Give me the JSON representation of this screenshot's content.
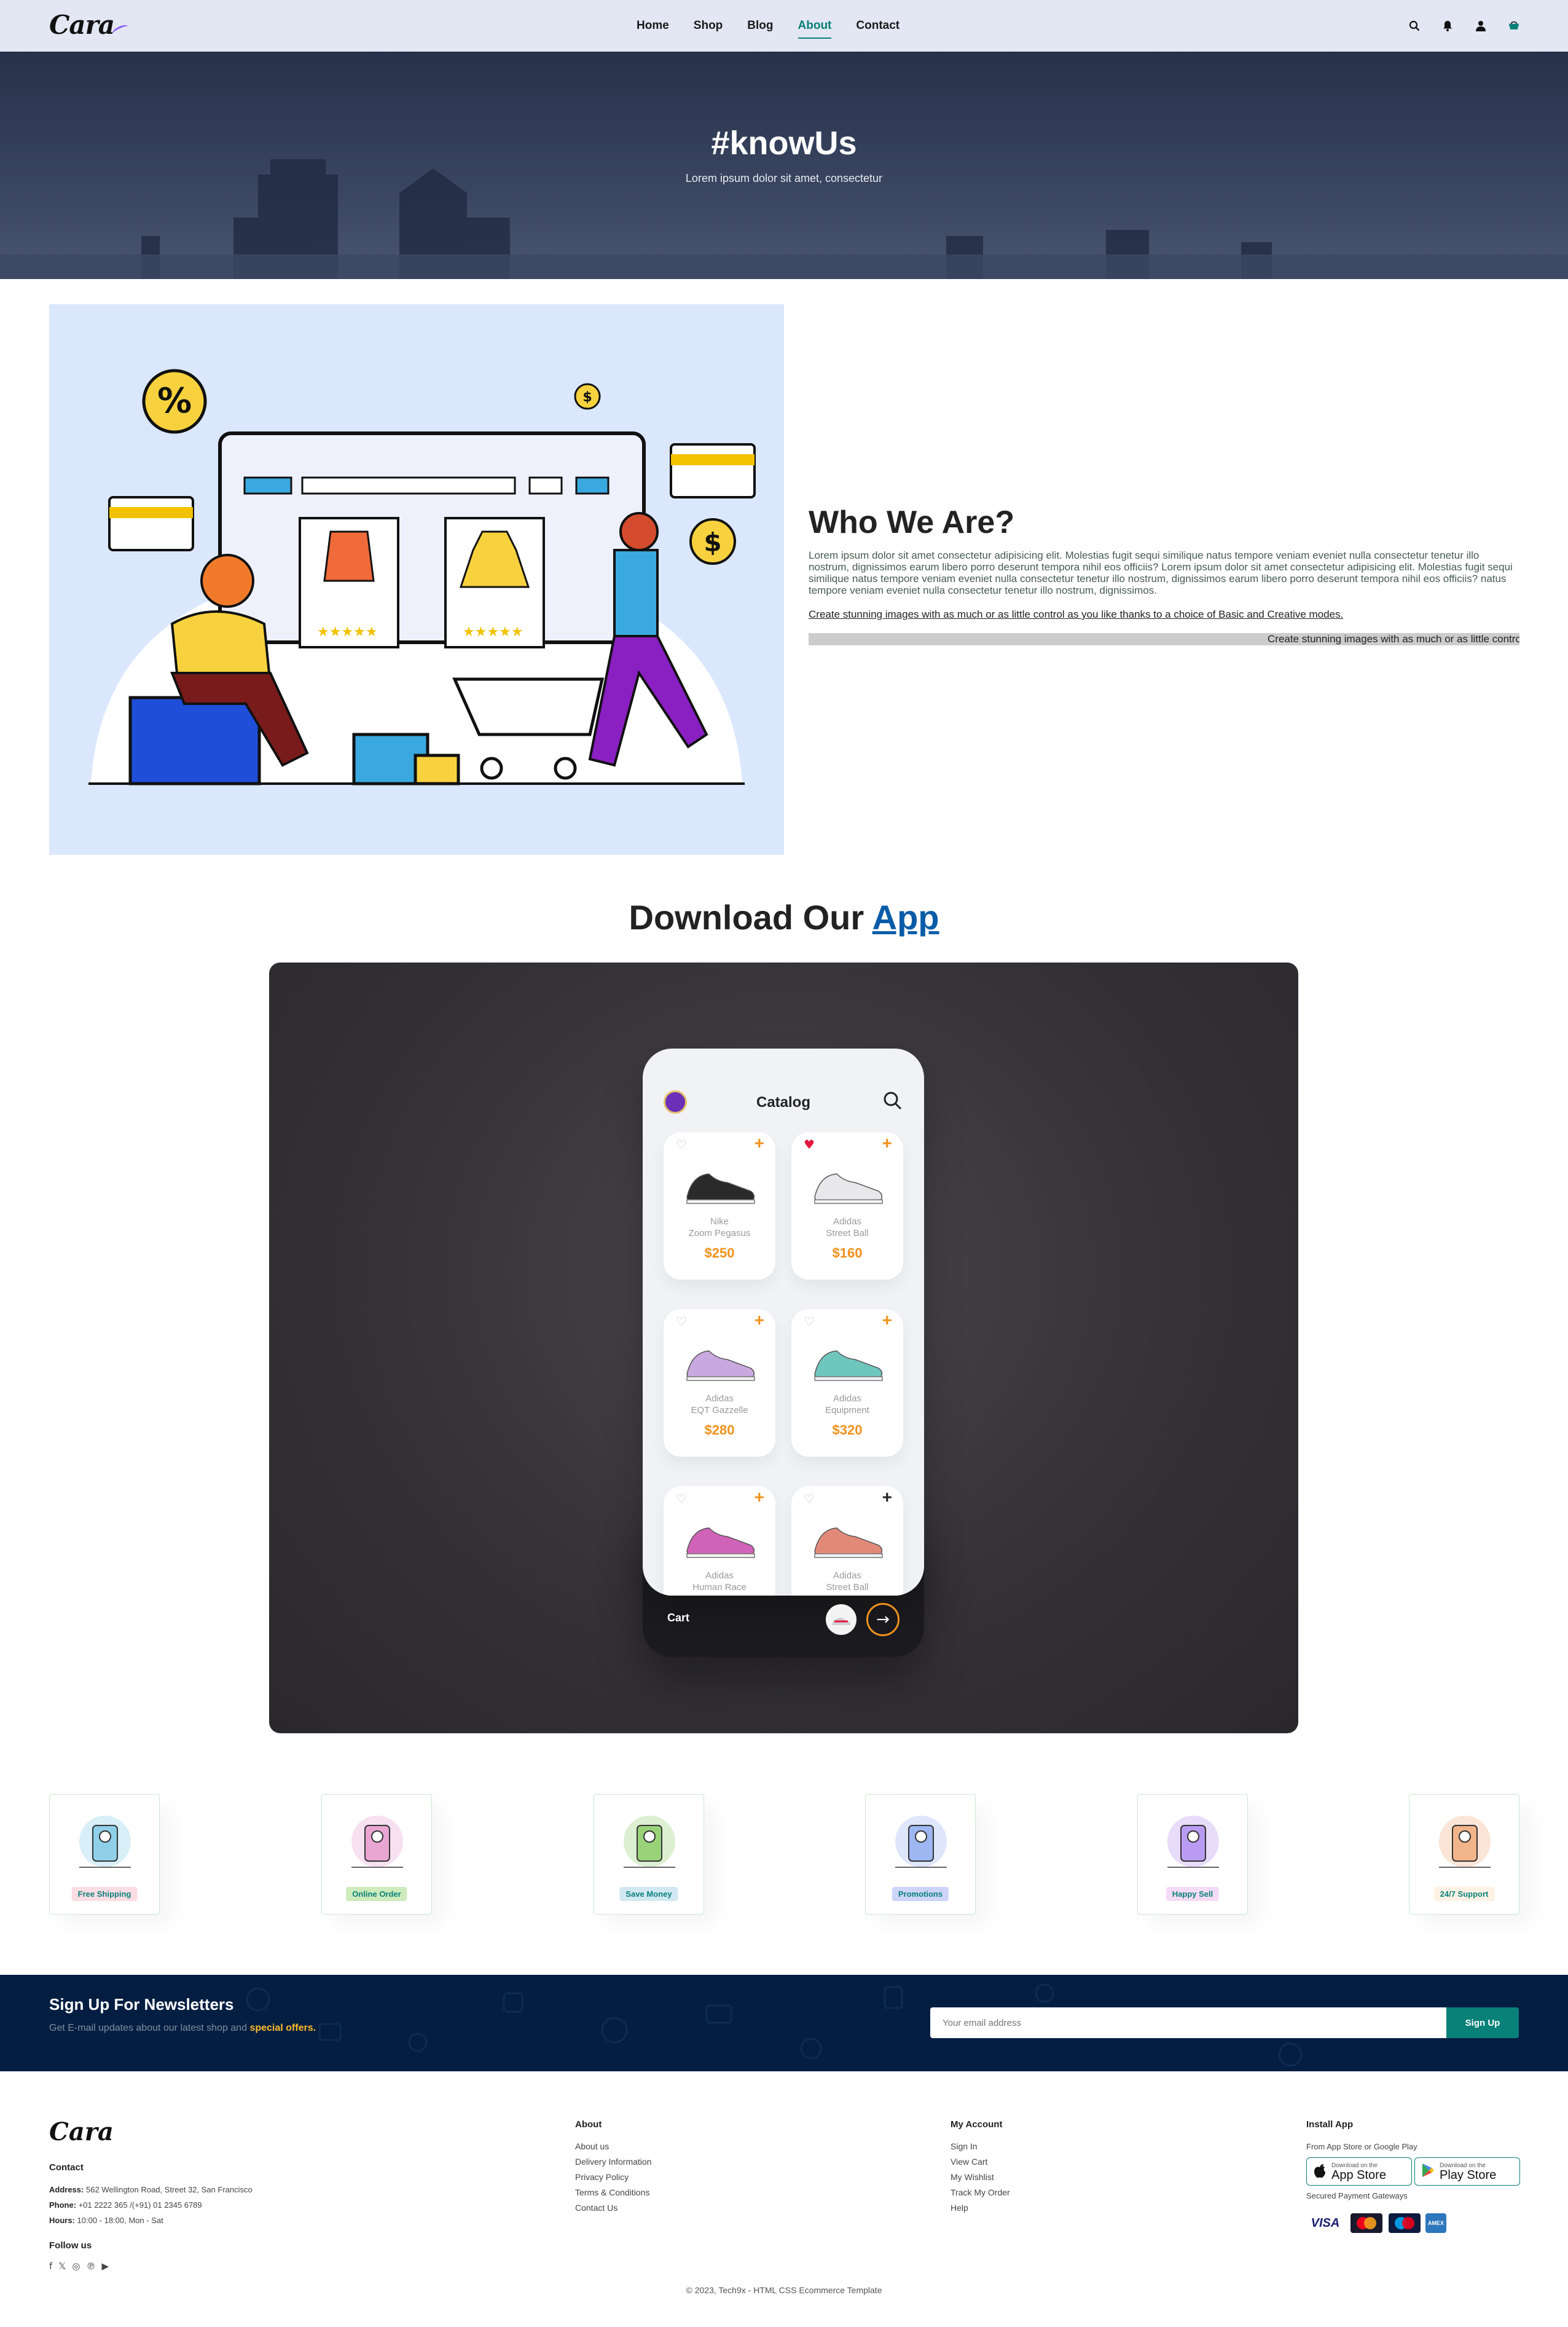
{
  "header": {
    "logo": "Cara",
    "nav": [
      "Home",
      "Shop",
      "Blog",
      "About",
      "Contact"
    ],
    "active_nav": "About",
    "icons": [
      "search-icon",
      "bell-icon",
      "user-icon",
      "cart-icon"
    ]
  },
  "hero": {
    "title": "#knowUs",
    "subtitle": "Lorem ipsum dolor sit amet, consectetur"
  },
  "about": {
    "title": "Who We Are?",
    "lead": "Lorem ipsum dolor sit amet consectetur adipisicing elit. Molestias fugit sequi similique natus tempore veniam eveniet nulla consectetur tenetur illo nostrum, dignissimos earum libero porro deserunt tempora nihil eos officiis? Lorem ipsum dolor sit amet consectetur adipisicing elit. Molestias fugit sequi similique natus tempore veniam eveniet nulla consectetur tenetur illo nostrum, dignissimos earum libero porro deserunt tempora nihil eos officiis? natus tempore veniam eveniet nulla consectetur tenetur illo nostrum, dignissimos.",
    "link_text": "Create stunning images with as much or as little control as you like thanks to a choice of Basic and Creative modes.",
    "marquee": "Create stunning images with as much or as little control as you like thanks to a choice of Basic and Creative modes."
  },
  "app": {
    "title_prefix": "Download Our",
    "title_link": "App",
    "screen_title": "Catalog",
    "cart_label": "Cart",
    "products": [
      {
        "brand": "Nike",
        "model": "Zoom Pegasus",
        "price": "$250",
        "liked": false,
        "plus_color": "orange",
        "shoe_color": "#2a2a2a"
      },
      {
        "brand": "Adidas",
        "model": "Street Ball",
        "price": "$160",
        "liked": true,
        "plus_color": "orange",
        "shoe_color": "#e8e8ea"
      },
      {
        "brand": "Adidas",
        "model": "EQT Gazzelle",
        "price": "$280",
        "liked": false,
        "plus_color": "orange",
        "shoe_color": "#c9a8e0"
      },
      {
        "brand": "Adidas",
        "model": "Equipment",
        "price": "$320",
        "liked": false,
        "plus_color": "orange",
        "shoe_color": "#6fc6bd"
      },
      {
        "brand": "Adidas",
        "model": "Human Race",
        "price": "",
        "liked": false,
        "plus_color": "orange",
        "shoe_color": "#d063b8"
      },
      {
        "brand": "Adidas",
        "model": "Street Ball",
        "price": "",
        "liked": false,
        "plus_color": "dark",
        "shoe_color": "#e28a78"
      }
    ]
  },
  "features": [
    {
      "label": "Free Shipping",
      "bg": "#fddde4"
    },
    {
      "label": "Online Order",
      "bg": "#cdebbc"
    },
    {
      "label": "Save Money",
      "bg": "#d1e8f2"
    },
    {
      "label": "Promotions",
      "bg": "#cdd4f8"
    },
    {
      "label": "Happy Sell",
      "bg": "#f6dbf6"
    },
    {
      "label": "24/7 Support",
      "bg": "#fff2e5"
    }
  ],
  "newsletter": {
    "title": "Sign Up For Newsletters",
    "text": "Get E-mail updates about our latest shop and",
    "highlight": "special offers.",
    "placeholder": "Your email address",
    "button": "Sign Up"
  },
  "footer": {
    "logo": "Cara",
    "contact_title": "Contact",
    "address_label": "Address:",
    "address": "562 Wellington Road, Street 32, San Francisco",
    "phone_label": "Phone:",
    "phone": "+01 2222 365 /(+91) 01 2345 6789",
    "hours_label": "Hours:",
    "hours": "10:00 - 18:00, Mon - Sat",
    "follow_title": "Follow us",
    "social": [
      "facebook-icon",
      "x-icon",
      "instagram-icon",
      "pinterest-icon",
      "youtube-icon"
    ],
    "about_title": "About",
    "about_links": [
      "About us",
      "Delivery Information",
      "Privacy Policy",
      "Terms & Conditions",
      "Contact Us"
    ],
    "account_title": "My Account",
    "account_links": [
      "Sign In",
      "View Cart",
      "My Wishlist",
      "Track My Order",
      "Help"
    ],
    "install_title": "Install App",
    "install_text": "From App Store or Google Play",
    "appstore_small": "Download on the",
    "appstore_big": "App Store",
    "playstore_small": "Download on the",
    "playstore_big": "Play Store",
    "payment_text": "Secured Payment Gateways",
    "payments": [
      "VISA",
      "Mastercard",
      "Maestro",
      "AMEX"
    ],
    "copyright": "© 2023, Tech9x - HTML CSS Ecommerce Template"
  }
}
